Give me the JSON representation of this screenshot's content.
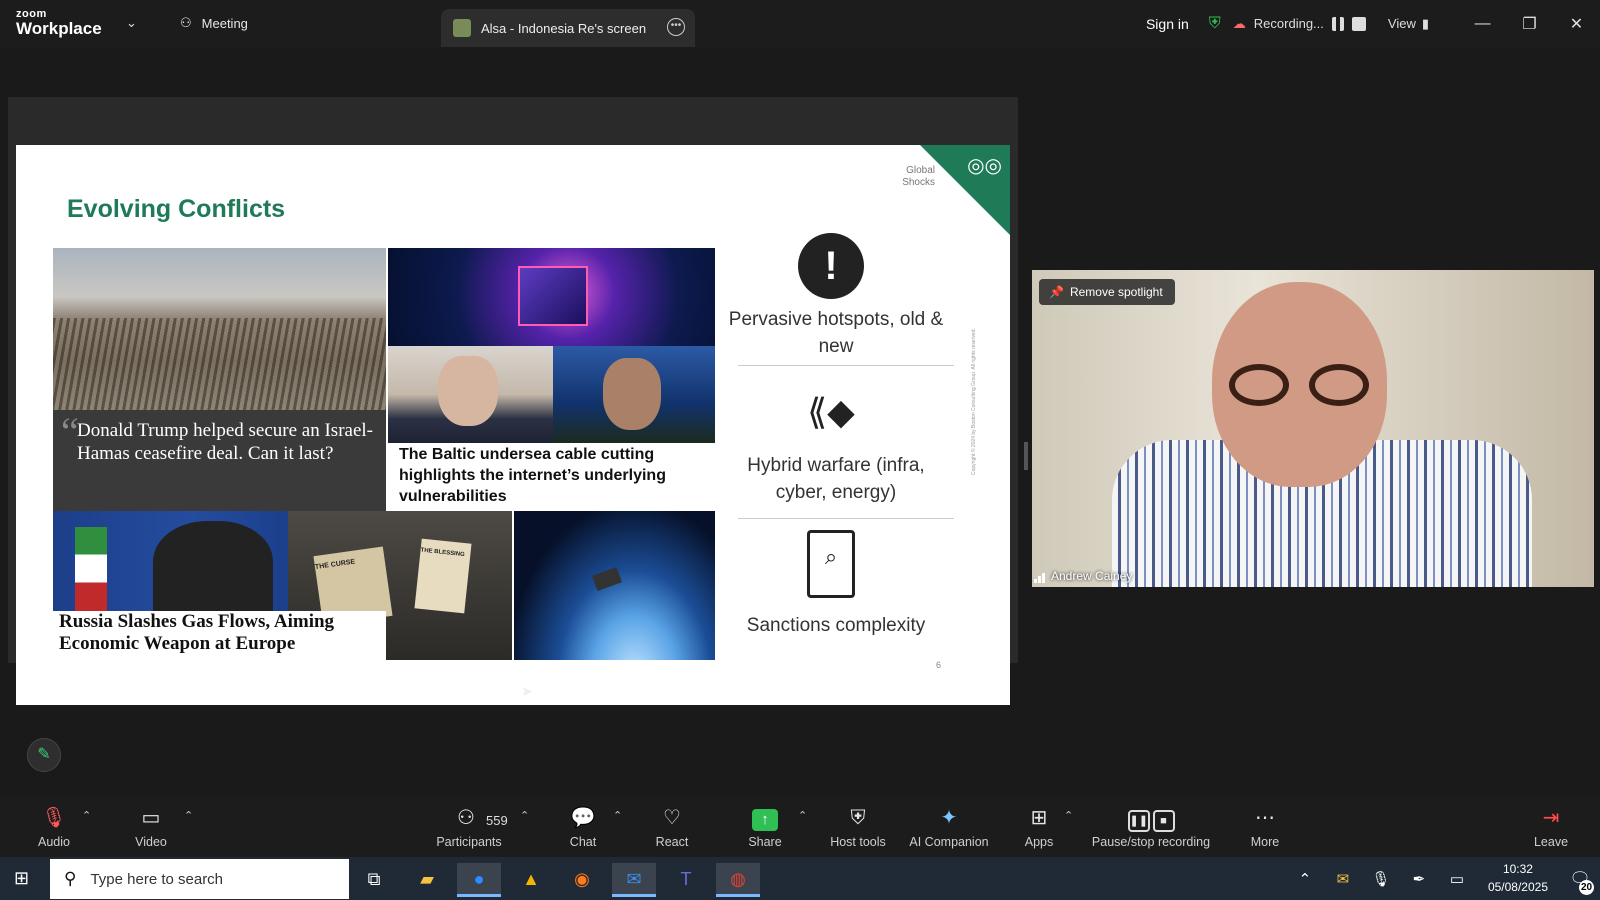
{
  "titlebar": {
    "brand_small": "zoom",
    "brand_big": "Workplace",
    "meeting_label": "Meeting",
    "screen_tab_label": "Alsa - Indonesia Re's screen",
    "sign_in": "Sign in",
    "recording": "Recording...",
    "view": "View"
  },
  "slide": {
    "title": "Evolving Conflicts",
    "corner_label": "Global\nShocks",
    "trump_headline": "Donald Trump helped secure an Israel-Hamas ceasefire deal. Can it last?",
    "baltic_headline": "The Baltic undersea cable cutting highlights the internet’s underlying vulnerabilities",
    "russia_headline": "Russia Slashes Gas Flows, Aiming Economic Weapon at Europe",
    "netanyahu_map_left": "THE CURSE",
    "netanyahu_map_right": "THE BLESSING",
    "item1": "Pervasive hotspots, old & new",
    "item2": "Hybrid warfare (infra, cyber, energy)",
    "item3": "Sanctions complexity",
    "copyright": "Copyright © 2024 by Boston Consulting Group. All rights reserved.",
    "page_number": "6"
  },
  "video": {
    "spotlight_button": "Remove spotlight",
    "participant_name": "Andrew Cainey"
  },
  "toolbar": {
    "audio": "Audio",
    "video": "Video",
    "participants": "Participants",
    "participant_count": "559",
    "chat": "Chat",
    "react": "React",
    "share": "Share",
    "host_tools": "Host tools",
    "ai_companion": "AI Companion",
    "apps": "Apps",
    "pause_stop": "Pause/stop recording",
    "more": "More",
    "leave": "Leave"
  },
  "taskbar": {
    "search_placeholder": "Type here to search",
    "time": "10:32",
    "date": "05/08/2025",
    "notifications": "20"
  },
  "colors": {
    "accent_green": "#1e7a57",
    "share_green": "#2fbf54",
    "leave_red": "#ff4b4b",
    "ai_blue": "#7cc7ff"
  }
}
